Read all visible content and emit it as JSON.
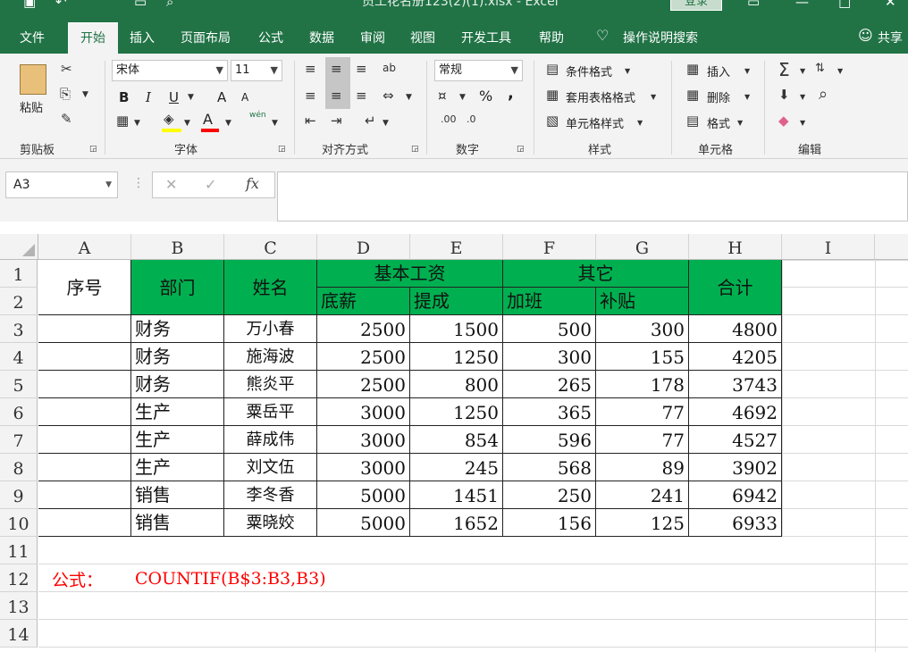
{
  "window": {
    "title": "员工花名册123(2)(1).xlsx - Excel",
    "login": "登录"
  },
  "tabs": [
    "文件",
    "开始",
    "插入",
    "页面布局",
    "公式",
    "数据",
    "审阅",
    "视图",
    "开发工具",
    "帮助"
  ],
  "active_tab": "开始",
  "tell_me": "操作说明搜索",
  "share": "共享",
  "ribbon": {
    "clipboard": {
      "paste": "粘贴",
      "label": "剪贴板"
    },
    "font": {
      "name": "宋体",
      "size": "11",
      "bold": "B",
      "italic": "I",
      "underline": "U",
      "grow": "A",
      "shrink": "A",
      "phonetic": "wén",
      "label": "字体"
    },
    "alignment": {
      "label": "对齐方式"
    },
    "number": {
      "format": "常规",
      "percent": "%",
      "comma": ",",
      "label": "数字"
    },
    "styles": {
      "conditional": "条件格式",
      "table": "套用表格格式",
      "cell": "单元格样式",
      "label": "样式"
    },
    "cells": {
      "insert": "插入",
      "delete": "删除",
      "format": "格式",
      "label": "单元格"
    },
    "editing": {
      "label": "编辑"
    }
  },
  "formula_bar": {
    "name_box": "A3",
    "cancel": "✕",
    "enter": "✓",
    "fx": "fx",
    "content": ""
  },
  "columns": [
    "A",
    "B",
    "C",
    "D",
    "E",
    "F",
    "G",
    "H",
    "I"
  ],
  "rows": [
    "1",
    "2",
    "3",
    "4",
    "5",
    "6",
    "7",
    "8",
    "9",
    "10",
    "11",
    "12",
    "13",
    "14"
  ],
  "headers": {
    "seq": "序号",
    "dept": "部门",
    "name": "姓名",
    "basic": "基本工资",
    "base": "底薪",
    "commission": "提成",
    "other": "其它",
    "overtime": "加班",
    "allowance": "补贴",
    "total": "合计"
  },
  "data": [
    [
      "财务",
      "万小春",
      "2500",
      "1500",
      "500",
      "300",
      "4800"
    ],
    [
      "财务",
      "施海波",
      "2500",
      "1250",
      "300",
      "155",
      "4205"
    ],
    [
      "财务",
      "熊炎平",
      "2500",
      "800",
      "265",
      "178",
      "3743"
    ],
    [
      "生产",
      "粟岳平",
      "3000",
      "1250",
      "365",
      "77",
      "4692"
    ],
    [
      "生产",
      "薛成伟",
      "3000",
      "854",
      "596",
      "77",
      "4527"
    ],
    [
      "生产",
      "刘文伍",
      "3000",
      "245",
      "568",
      "89",
      "3902"
    ],
    [
      "销售",
      "李冬香",
      "5000",
      "1451",
      "250",
      "241",
      "6942"
    ],
    [
      "销售",
      "粟晓姣",
      "5000",
      "1652",
      "156",
      "125",
      "6933"
    ]
  ],
  "note": {
    "label": "公式：",
    "formula": "COUNTIF(B$3:B3,B3)"
  },
  "colors": {
    "brand": "#217346",
    "header_fill": "#00b050",
    "note": "#ff0000"
  }
}
